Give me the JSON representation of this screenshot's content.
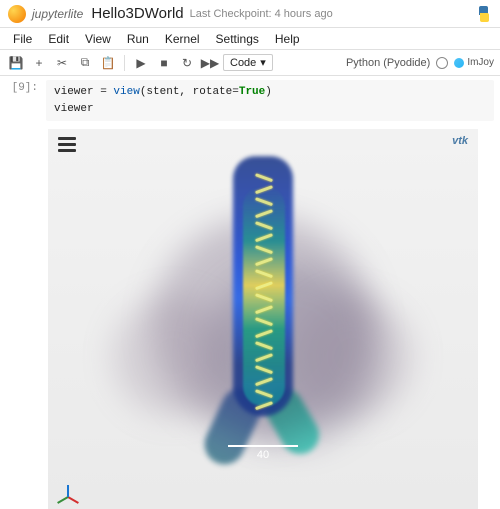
{
  "header": {
    "brand": "jupyterlite",
    "title": "Hello3DWorld",
    "checkpoint": "Last Checkpoint: 4 hours ago"
  },
  "menu": {
    "items": [
      "File",
      "Edit",
      "View",
      "Run",
      "Kernel",
      "Settings",
      "Help"
    ]
  },
  "toolbar": {
    "save_icon": "💾",
    "add_icon": "+",
    "cut_icon": "✂",
    "copy_icon": "⧉",
    "paste_icon": "📋",
    "run_icon": "▶",
    "stop_icon": "■",
    "restart_icon": "↻",
    "restart_run_icon": "▶▶",
    "cell_type": "Code",
    "kernel_name": "Python (Pyodide)",
    "imjoy_label": "ImJoy"
  },
  "cell": {
    "prompt": "[9]:",
    "code_line1_a": "viewer = ",
    "code_line1_fn": "view",
    "code_line1_b": "(stent, rotate=",
    "code_line1_kw": "True",
    "code_line1_c": ")",
    "code_line2": "viewer"
  },
  "viewer": {
    "vtk_label": "vtk",
    "scale_value": "40"
  }
}
